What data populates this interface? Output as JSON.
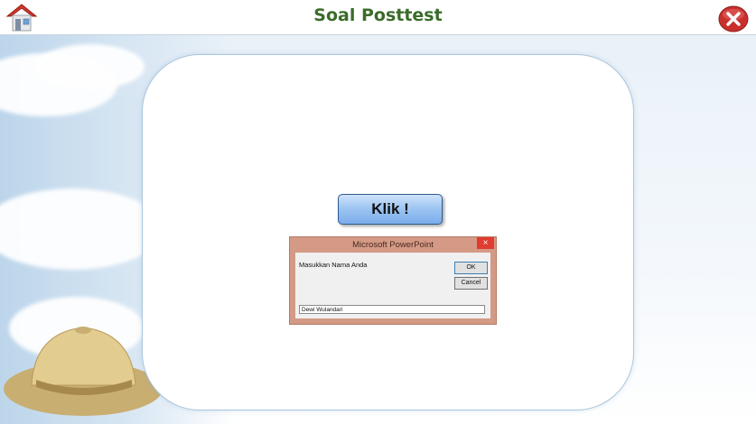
{
  "header": {
    "title": "Soal Posttest",
    "home_icon": "house-icon",
    "close_icon": "red-x-circle-icon",
    "title_color": "#3a6b2a"
  },
  "main": {
    "button_label": "Klik !"
  },
  "dialog": {
    "title": "Microsoft PowerPoint",
    "close_glyph": "×",
    "prompt": "Masukkan Nama Anda",
    "ok_label": "OK",
    "cancel_label": "Cancel",
    "input_value": "Dewi Wulandari"
  }
}
